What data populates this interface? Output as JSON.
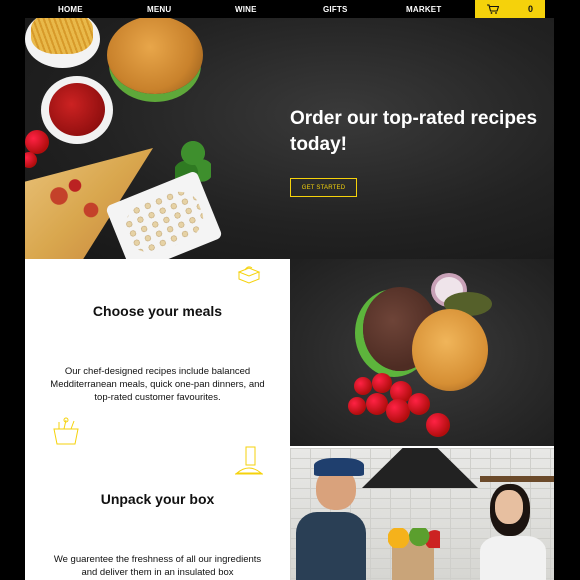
{
  "nav": {
    "items": [
      "HOME",
      "MENU",
      "WINE",
      "GIFTS",
      "MARKET"
    ],
    "cart_count": "0",
    "accent": "#f5d20b"
  },
  "hero": {
    "title": "Order our top-rated recipes today!",
    "cta": "GET STARTED"
  },
  "sections": [
    {
      "title": "Choose your meals",
      "text": "Our chef-designed recipes include balanced Medditerranean meals, quick one-pan dinners, and top-rated customer favourites."
    },
    {
      "title": "Unpack your box",
      "text": "We guarentee the freshness of all our ingredients and deliver them in an insulated box"
    }
  ],
  "icons": [
    "cart-icon",
    "takeout-box-icon",
    "grocery-basket-icon",
    "drink-and-food-icon"
  ]
}
